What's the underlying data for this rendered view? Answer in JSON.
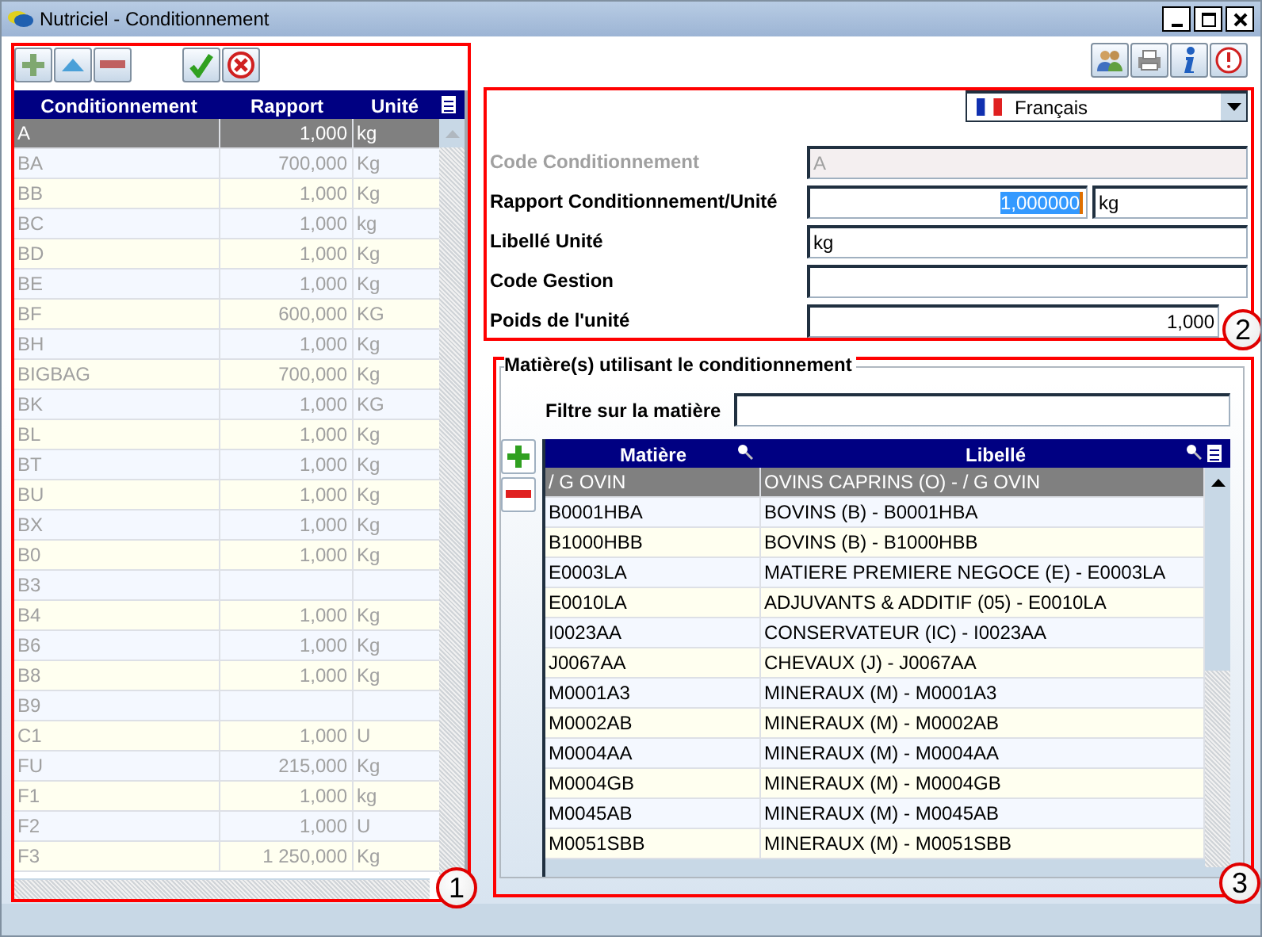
{
  "window": {
    "title": "Nutriciel - Conditionnement"
  },
  "packaging_table": {
    "disabled": true,
    "columns": [
      "Conditionnement",
      "Rapport",
      "Unité"
    ],
    "rows": [
      {
        "cells": [
          "A",
          "1,000",
          "kg"
        ],
        "selected": true
      },
      {
        "cells": [
          "BA",
          "700,000",
          "Kg"
        ],
        "selected": false
      },
      {
        "cells": [
          "BB",
          "1,000",
          "Kg"
        ],
        "selected": false
      },
      {
        "cells": [
          "BC",
          "1,000",
          "kg"
        ],
        "selected": false
      },
      {
        "cells": [
          "BD",
          "1,000",
          "Kg"
        ],
        "selected": false
      },
      {
        "cells": [
          "BE",
          "1,000",
          "Kg"
        ],
        "selected": false
      },
      {
        "cells": [
          "BF",
          "600,000",
          "KG"
        ],
        "selected": false
      },
      {
        "cells": [
          "BH",
          "1,000",
          "Kg"
        ],
        "selected": false
      },
      {
        "cells": [
          "BIGBAG",
          "700,000",
          "Kg"
        ],
        "selected": false
      },
      {
        "cells": [
          "BK",
          "1,000",
          "KG"
        ],
        "selected": false
      },
      {
        "cells": [
          "BL",
          "1,000",
          "Kg"
        ],
        "selected": false
      },
      {
        "cells": [
          "BT",
          "1,000",
          "Kg"
        ],
        "selected": false
      },
      {
        "cells": [
          "BU",
          "1,000",
          "Kg"
        ],
        "selected": false
      },
      {
        "cells": [
          "BX",
          "1,000",
          "Kg"
        ],
        "selected": false
      },
      {
        "cells": [
          "B0",
          "1,000",
          "Kg"
        ],
        "selected": false
      },
      {
        "cells": [
          "B3"
        ],
        "selected": false
      },
      {
        "cells": [
          "B4",
          "1,000",
          "Kg"
        ],
        "selected": false
      },
      {
        "cells": [
          "B6",
          "1,000",
          "Kg"
        ],
        "selected": false
      },
      {
        "cells": [
          "B8",
          "1,000",
          "Kg"
        ],
        "selected": false
      },
      {
        "cells": [
          "B9"
        ],
        "selected": false
      },
      {
        "cells": [
          "C1",
          "1,000",
          "U"
        ],
        "selected": false
      },
      {
        "cells": [
          "FU",
          "215,000",
          "Kg"
        ],
        "selected": false
      },
      {
        "cells": [
          "F1",
          "1,000",
          "kg"
        ],
        "selected": false
      },
      {
        "cells": [
          "F2",
          "1,000",
          "U"
        ],
        "selected": false
      },
      {
        "cells": [
          "F3",
          "1 250,000",
          "Kg"
        ],
        "selected": false
      }
    ]
  },
  "language": {
    "value": "Français"
  },
  "form": {
    "fields": [
      {
        "label": "Code Conditionnement",
        "kind": "text",
        "value": "A",
        "disabled": true,
        "text_selected": false
      },
      {
        "label": "Rapport Conditionnement/Unité",
        "kind": "number",
        "value": "1,000000",
        "unit": "kg",
        "disabled": false,
        "text_selected": true
      },
      {
        "label": "Libellé Unité",
        "kind": "text",
        "value": "kg",
        "disabled": false,
        "text_selected": false
      },
      {
        "label": "Code Gestion",
        "kind": "text",
        "disabled": false,
        "text_selected": false
      },
      {
        "label": "Poids de l'unité",
        "kind": "number",
        "value": "1,000",
        "disabled": false,
        "text_selected": false
      }
    ]
  },
  "materials": {
    "title": "Matière(s) utilisant le conditionnement",
    "filter": {
      "label": "Filtre sur la matière"
    },
    "columns": [
      "Matière",
      "Libellé"
    ],
    "rows": [
      {
        "cells": [
          "/ G OVIN",
          "OVINS CAPRINS (O) - / G OVIN"
        ],
        "selected": true
      },
      {
        "cells": [
          "B0001HBA",
          "BOVINS (B) - B0001HBA"
        ],
        "selected": false
      },
      {
        "cells": [
          "B1000HBB",
          "BOVINS (B) - B1000HBB"
        ],
        "selected": false
      },
      {
        "cells": [
          "E0003LA",
          "MATIERE PREMIERE NEGOCE (E) - E0003LA"
        ],
        "selected": false
      },
      {
        "cells": [
          "E0010LA",
          "ADJUVANTS & ADDITIF (05) - E0010LA"
        ],
        "selected": false
      },
      {
        "cells": [
          "I0023AA",
          "CONSERVATEUR (IC) - I0023AA"
        ],
        "selected": false
      },
      {
        "cells": [
          "J0067AA",
          "CHEVAUX (J) - J0067AA"
        ],
        "selected": false
      },
      {
        "cells": [
          "M0001A3",
          "MINERAUX (M) - M0001A3"
        ],
        "selected": false
      },
      {
        "cells": [
          "M0002AB",
          "MINERAUX (M) - M0002AB"
        ],
        "selected": false
      },
      {
        "cells": [
          "M0004AA",
          "MINERAUX (M) - M0004AA"
        ],
        "selected": false
      },
      {
        "cells": [
          "M0004GB",
          "MINERAUX (M) - M0004GB"
        ],
        "selected": false
      },
      {
        "cells": [
          "M0045AB",
          "MINERAUX (M) - M0045AB"
        ],
        "selected": false
      },
      {
        "cells": [
          "M0051SBB",
          "MINERAUX (M) - M0051SBB"
        ],
        "selected": false
      }
    ]
  },
  "callouts": [
    "1",
    "2",
    "3"
  ]
}
